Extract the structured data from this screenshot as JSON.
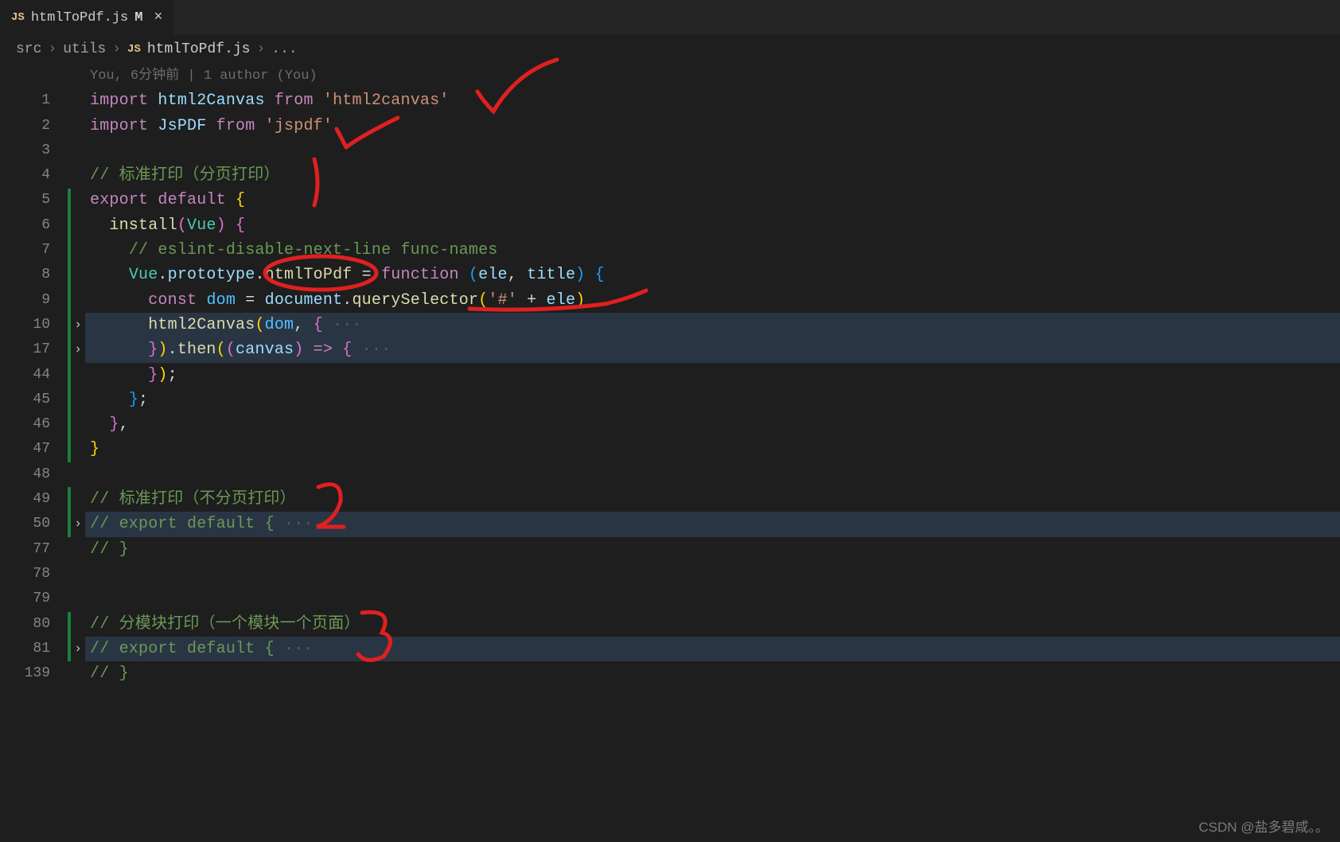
{
  "tab": {
    "icon_label": "JS",
    "filename": "htmlToPdf.js",
    "modified_marker": "M",
    "close_glyph": "×"
  },
  "breadcrumbs": {
    "seg1": "src",
    "sep": "›",
    "seg2": "utils",
    "icon_label": "JS",
    "file": "htmlToPdf.js",
    "rest": "..."
  },
  "authorship": "You, 6分钟前 | 1 author (You)",
  "fold_glyph": "›",
  "code": {
    "ln1": {
      "n": "1",
      "tokens": [
        [
          "kw",
          "import"
        ],
        [
          "op",
          " "
        ],
        [
          "id",
          "html2Canvas"
        ],
        [
          "op",
          " "
        ],
        [
          "kw",
          "from"
        ],
        [
          "op",
          " "
        ],
        [
          "str",
          "'html2canvas'"
        ]
      ]
    },
    "ln2": {
      "n": "2",
      "tokens": [
        [
          "kw",
          "import"
        ],
        [
          "op",
          " "
        ],
        [
          "id",
          "JsPDF"
        ],
        [
          "op",
          " "
        ],
        [
          "kw",
          "from"
        ],
        [
          "op",
          " "
        ],
        [
          "str",
          "'jspdf'"
        ]
      ]
    },
    "ln3": {
      "n": "3",
      "tokens": []
    },
    "ln4": {
      "n": "4",
      "tokens": [
        [
          "cm",
          "// 标准打印（分页打印）"
        ]
      ]
    },
    "ln5": {
      "n": "5",
      "tokens": [
        [
          "kw",
          "export"
        ],
        [
          "op",
          " "
        ],
        [
          "kw",
          "default"
        ],
        [
          "op",
          " "
        ],
        [
          "ybr",
          "{"
        ]
      ]
    },
    "ln6": {
      "n": "6",
      "tokens": [
        [
          "op",
          "  "
        ],
        [
          "fn",
          "install"
        ],
        [
          "pbr",
          "("
        ],
        [
          "type",
          "Vue"
        ],
        [
          "pbr",
          ")"
        ],
        [
          "op",
          " "
        ],
        [
          "pbr",
          "{"
        ]
      ]
    },
    "ln7": {
      "n": "7",
      "tokens": [
        [
          "op",
          "    "
        ],
        [
          "cm",
          "// eslint-disable-next-line func-names"
        ]
      ]
    },
    "ln8": {
      "n": "8",
      "tokens": [
        [
          "op",
          "    "
        ],
        [
          "type",
          "Vue"
        ],
        [
          "op",
          "."
        ],
        [
          "var",
          "prototype"
        ],
        [
          "op",
          "."
        ],
        [
          "fn",
          "htmlToPdf"
        ],
        [
          "op",
          " = "
        ],
        [
          "kw",
          "function"
        ],
        [
          "op",
          " "
        ],
        [
          "bbr",
          "("
        ],
        [
          "var",
          "ele"
        ],
        [
          "op",
          ", "
        ],
        [
          "var",
          "title"
        ],
        [
          "bbr",
          ")"
        ],
        [
          "op",
          " "
        ],
        [
          "bbr",
          "{"
        ]
      ]
    },
    "ln9": {
      "n": "9",
      "tokens": [
        [
          "op",
          "      "
        ],
        [
          "kw",
          "const"
        ],
        [
          "op",
          " "
        ],
        [
          "const",
          "dom"
        ],
        [
          "op",
          " = "
        ],
        [
          "var",
          "document"
        ],
        [
          "op",
          "."
        ],
        [
          "fn",
          "querySelector"
        ],
        [
          "ybr",
          "("
        ],
        [
          "str",
          "'#'"
        ],
        [
          "op",
          " + "
        ],
        [
          "var",
          "ele"
        ],
        [
          "ybr",
          ")"
        ]
      ]
    },
    "ln10": {
      "n": "10",
      "tokens": [
        [
          "op",
          "      "
        ],
        [
          "fn",
          "html2Canvas"
        ],
        [
          "ybr",
          "("
        ],
        [
          "const",
          "dom"
        ],
        [
          "op",
          ", "
        ],
        [
          "pbr",
          "{"
        ],
        [
          "fade",
          " ···"
        ]
      ]
    },
    "ln17": {
      "n": "17",
      "tokens": [
        [
          "op",
          "      "
        ],
        [
          "pbr",
          "}"
        ],
        [
          "ybr",
          ")"
        ],
        [
          "op",
          "."
        ],
        [
          "fn",
          "then"
        ],
        [
          "ybr",
          "("
        ],
        [
          "pbr",
          "("
        ],
        [
          "var",
          "canvas"
        ],
        [
          "pbr",
          ")"
        ],
        [
          "op",
          " "
        ],
        [
          "kw",
          "=>"
        ],
        [
          "op",
          " "
        ],
        [
          "pbr",
          "{"
        ],
        [
          "fade",
          " ···"
        ]
      ]
    },
    "ln44": {
      "n": "44",
      "tokens": [
        [
          "op",
          "      "
        ],
        [
          "pbr",
          "}"
        ],
        [
          "ybr",
          ")"
        ],
        [
          "op",
          ";"
        ]
      ]
    },
    "ln45": {
      "n": "45",
      "tokens": [
        [
          "op",
          "    "
        ],
        [
          "bbr",
          "}"
        ],
        [
          "op",
          ";"
        ]
      ]
    },
    "ln46": {
      "n": "46",
      "tokens": [
        [
          "op",
          "  "
        ],
        [
          "pbr",
          "}"
        ],
        [
          "op",
          ","
        ]
      ]
    },
    "ln47": {
      "n": "47",
      "tokens": [
        [
          "ybr",
          "}"
        ]
      ]
    },
    "ln48": {
      "n": "48",
      "tokens": []
    },
    "ln49": {
      "n": "49",
      "tokens": [
        [
          "cm",
          "// 标准打印（不分页打印）"
        ]
      ]
    },
    "ln50": {
      "n": "50",
      "tokens": [
        [
          "cm",
          "// export default {"
        ],
        [
          "fade",
          " ···"
        ]
      ]
    },
    "ln77": {
      "n": "77",
      "tokens": [
        [
          "cm",
          "// }"
        ]
      ]
    },
    "ln78": {
      "n": "78",
      "tokens": []
    },
    "ln79": {
      "n": "79",
      "tokens": []
    },
    "ln80": {
      "n": "80",
      "tokens": [
        [
          "cm",
          "// 分模块打印（一个模块一个页面）"
        ]
      ]
    },
    "ln81": {
      "n": "81",
      "tokens": [
        [
          "cm",
          "// export default {"
        ],
        [
          "fade",
          " ···"
        ]
      ]
    },
    "ln139": {
      "n": "139",
      "tokens": [
        [
          "cm",
          "// }"
        ]
      ]
    }
  },
  "line_order": [
    "ln1",
    "ln2",
    "ln3",
    "ln4",
    "ln5",
    "ln6",
    "ln7",
    "ln8",
    "ln9",
    "ln10",
    "ln17",
    "ln44",
    "ln45",
    "ln46",
    "ln47",
    "ln48",
    "ln49",
    "ln50",
    "ln77",
    "ln78",
    "ln79",
    "ln80",
    "ln81",
    "ln139"
  ],
  "folds_at": [
    "ln10",
    "ln17",
    "ln50",
    "ln81"
  ],
  "highlighted_rows": [
    "ln10",
    "ln17",
    "ln50",
    "ln81"
  ],
  "gitbar_ranges": [
    {
      "from": "ln5",
      "to": "ln47"
    },
    {
      "from": "ln49",
      "to": "ln50"
    },
    {
      "from": "ln80",
      "to": "ln81"
    }
  ],
  "watermark": "CSDN @盐多碧咸。。"
}
